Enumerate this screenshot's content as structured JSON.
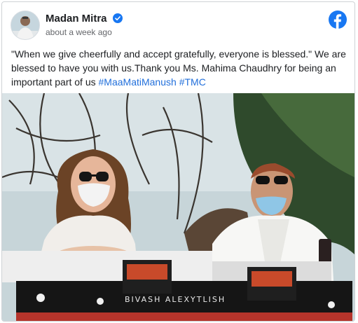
{
  "post": {
    "author": "Madan Mitra",
    "timestamp": "about a week ago",
    "text_main": "\"When we give cheerfully and accept gratefully, everyone is blessed.\" We are blessed to have you with us.Thank you Ms. Mahima Chaudhry for being an important part of us",
    "hashtags": [
      "#MaaMatiManush",
      "#TMC"
    ],
    "photo_watermark": "BIVASH ALEXYTLISH"
  },
  "icons": {
    "verified": "verified-badge-icon",
    "platform": "facebook-logo-icon"
  },
  "colors": {
    "link": "#216fdb",
    "facebook_blue": "#1877f2",
    "verified_blue": "#1877f2"
  }
}
